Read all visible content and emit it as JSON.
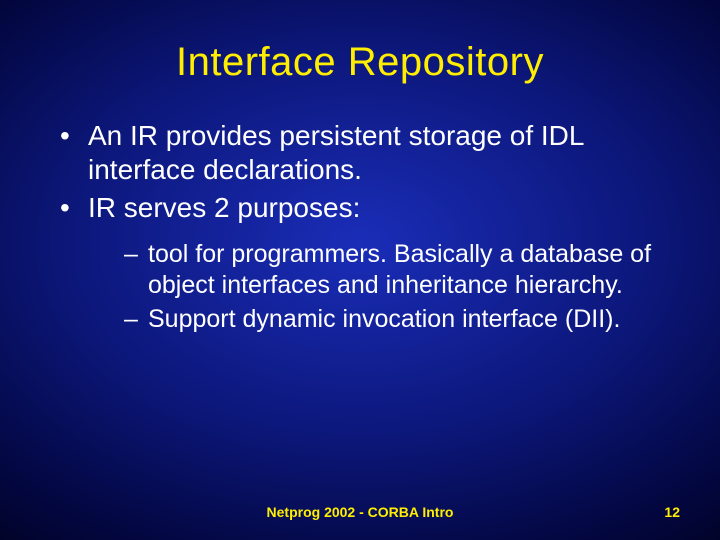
{
  "title": "Interface Repository",
  "bullets": [
    {
      "text": "An IR provides persistent storage of IDL interface declarations."
    },
    {
      "text": "IR serves 2 purposes:"
    }
  ],
  "subbullets": [
    {
      "text": "tool for programmers. Basically a database of object interfaces and inheritance hierarchy."
    },
    {
      "text": "Support dynamic invocation interface (DII)."
    }
  ],
  "footer": {
    "center": "Netprog 2002  -  CORBA Intro",
    "page": "12"
  }
}
